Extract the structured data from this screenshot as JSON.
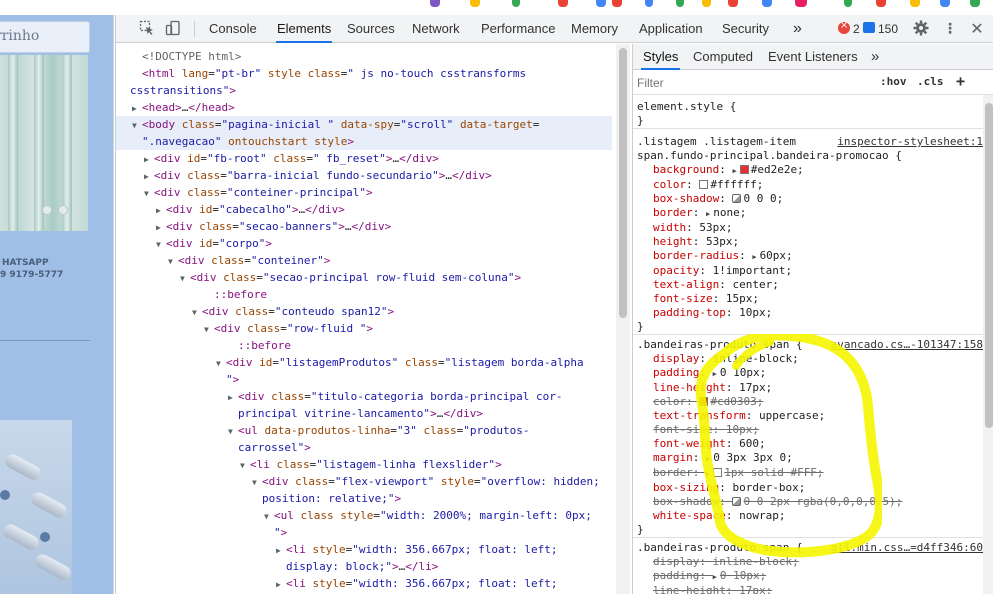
{
  "page_preview": {
    "search_text": "rrinho",
    "whatsapp_label": "HATSAPP",
    "phone": "9 9179-5777"
  },
  "toolbar": {
    "tabs": [
      "Console",
      "Elements",
      "Sources",
      "Network",
      "Performance",
      "Memory",
      "Application",
      "Security"
    ],
    "active_tab": "Elements",
    "more_tabs": "»",
    "error_count": "2",
    "message_count": "150"
  },
  "elements_tree": [
    {
      "indent": 12,
      "tri": "",
      "html": "<!DOCTYPE html>",
      "kind": "comment"
    },
    {
      "indent": 12,
      "tri": "",
      "parts": [
        [
          "t",
          "<html "
        ],
        [
          "a",
          "lang"
        ],
        [
          "p",
          "="
        ],
        [
          "v",
          "\"pt-br\""
        ],
        [
          "p",
          " "
        ],
        [
          "a",
          "style"
        ],
        [
          "p",
          " "
        ],
        [
          "a",
          "class"
        ],
        [
          "p",
          "="
        ],
        [
          "v",
          "\" js no-touch csstransforms"
        ]
      ]
    },
    {
      "indent": 0,
      "tri": "",
      "parts": [
        [
          "v",
          "csstransitions\""
        ],
        [
          "t",
          ">"
        ]
      ]
    },
    {
      "indent": 12,
      "tri": "▶",
      "parts": [
        [
          "t",
          "<head>"
        ],
        [
          "p",
          "…"
        ],
        [
          "t",
          "</head>"
        ]
      ]
    },
    {
      "indent": 12,
      "tri": "▼",
      "sel": true,
      "parts": [
        [
          "t",
          "<body "
        ],
        [
          "a",
          "class"
        ],
        [
          "p",
          "="
        ],
        [
          "v",
          "\"pagina-inicial   \""
        ],
        [
          "p",
          " "
        ],
        [
          "a",
          "data-spy"
        ],
        [
          "p",
          "="
        ],
        [
          "v",
          "\"scroll\""
        ],
        [
          "p",
          " "
        ],
        [
          "a",
          "data-target"
        ],
        [
          "p",
          "="
        ]
      ]
    },
    {
      "indent": 12,
      "tri": "",
      "sel": true,
      "parts": [
        [
          "v",
          "\".navegacao\""
        ],
        [
          "p",
          " "
        ],
        [
          "a",
          "ontouchstart"
        ],
        [
          "p",
          " "
        ],
        [
          "a",
          "style"
        ],
        [
          "t",
          ">"
        ]
      ]
    },
    {
      "indent": 24,
      "tri": "▶",
      "parts": [
        [
          "t",
          "<div "
        ],
        [
          "a",
          "id"
        ],
        [
          "p",
          "="
        ],
        [
          "v",
          "\"fb-root\""
        ],
        [
          "p",
          " "
        ],
        [
          "a",
          "class"
        ],
        [
          "p",
          "="
        ],
        [
          "v",
          "\" fb_reset\""
        ],
        [
          "t",
          ">"
        ],
        [
          "p",
          "…"
        ],
        [
          "t",
          "</div>"
        ]
      ]
    },
    {
      "indent": 24,
      "tri": "▶",
      "parts": [
        [
          "t",
          "<div "
        ],
        [
          "a",
          "class"
        ],
        [
          "p",
          "="
        ],
        [
          "v",
          "\"barra-inicial fundo-secundario\""
        ],
        [
          "t",
          ">"
        ],
        [
          "p",
          "…"
        ],
        [
          "t",
          "</div>"
        ]
      ]
    },
    {
      "indent": 24,
      "tri": "▼",
      "parts": [
        [
          "t",
          "<div "
        ],
        [
          "a",
          "class"
        ],
        [
          "p",
          "="
        ],
        [
          "v",
          "\"conteiner-principal\""
        ],
        [
          "t",
          ">"
        ]
      ]
    },
    {
      "indent": 36,
      "tri": "▶",
      "parts": [
        [
          "t",
          "<div "
        ],
        [
          "a",
          "id"
        ],
        [
          "p",
          "="
        ],
        [
          "v",
          "\"cabecalho\""
        ],
        [
          "t",
          ">"
        ],
        [
          "p",
          "…"
        ],
        [
          "t",
          "</div>"
        ]
      ]
    },
    {
      "indent": 36,
      "tri": "▶",
      "parts": [
        [
          "t",
          "<div "
        ],
        [
          "a",
          "class"
        ],
        [
          "p",
          "="
        ],
        [
          "v",
          "\"secao-banners\""
        ],
        [
          "t",
          ">"
        ],
        [
          "p",
          "…"
        ],
        [
          "t",
          "</div>"
        ]
      ]
    },
    {
      "indent": 36,
      "tri": "▼",
      "parts": [
        [
          "t",
          "<div "
        ],
        [
          "a",
          "id"
        ],
        [
          "p",
          "="
        ],
        [
          "v",
          "\"corpo\""
        ],
        [
          "t",
          ">"
        ]
      ]
    },
    {
      "indent": 48,
      "tri": "▼",
      "parts": [
        [
          "t",
          "<div "
        ],
        [
          "a",
          "class"
        ],
        [
          "p",
          "="
        ],
        [
          "v",
          "\"conteiner\""
        ],
        [
          "t",
          ">"
        ]
      ]
    },
    {
      "indent": 60,
      "tri": "▼",
      "parts": [
        [
          "t",
          "<div "
        ],
        [
          "a",
          "class"
        ],
        [
          "p",
          "="
        ],
        [
          "v",
          "\"secao-principal row-fluid sem-coluna\""
        ],
        [
          "t",
          ">"
        ]
      ]
    },
    {
      "indent": 84,
      "tri": "",
      "parts": [
        [
          "s",
          "::before"
        ]
      ]
    },
    {
      "indent": 72,
      "tri": "▼",
      "parts": [
        [
          "t",
          "<div "
        ],
        [
          "a",
          "class"
        ],
        [
          "p",
          "="
        ],
        [
          "v",
          "\"conteudo span12\""
        ],
        [
          "t",
          ">"
        ]
      ]
    },
    {
      "indent": 84,
      "tri": "▼",
      "parts": [
        [
          "t",
          "<div "
        ],
        [
          "a",
          "class"
        ],
        [
          "p",
          "="
        ],
        [
          "v",
          "\"row-fluid \""
        ],
        [
          "t",
          ">"
        ]
      ]
    },
    {
      "indent": 108,
      "tri": "",
      "parts": [
        [
          "s",
          "::before"
        ]
      ]
    },
    {
      "indent": 96,
      "tri": "▼",
      "parts": [
        [
          "t",
          "<div "
        ],
        [
          "a",
          "id"
        ],
        [
          "p",
          "="
        ],
        [
          "v",
          "\"listagemProdutos\""
        ],
        [
          "p",
          " "
        ],
        [
          "a",
          "class"
        ],
        [
          "p",
          "="
        ],
        [
          "v",
          "\"listagem borda-alpha"
        ]
      ]
    },
    {
      "indent": 96,
      "tri": "",
      "parts": [
        [
          "v",
          "\""
        ],
        [
          "t",
          ">"
        ]
      ]
    },
    {
      "indent": 108,
      "tri": "▶",
      "parts": [
        [
          "t",
          "<div "
        ],
        [
          "a",
          "class"
        ],
        [
          "p",
          "="
        ],
        [
          "v",
          "\"titulo-categoria borda-principal cor-"
        ]
      ]
    },
    {
      "indent": 108,
      "tri": "",
      "parts": [
        [
          "v",
          "principal vitrine-lancamento\""
        ],
        [
          "t",
          ">"
        ],
        [
          "p",
          "…"
        ],
        [
          "t",
          "</div>"
        ]
      ]
    },
    {
      "indent": 108,
      "tri": "▼",
      "parts": [
        [
          "t",
          "<ul "
        ],
        [
          "a",
          "data-produtos-linha"
        ],
        [
          "p",
          "="
        ],
        [
          "v",
          "\"3\""
        ],
        [
          "p",
          " "
        ],
        [
          "a",
          "class"
        ],
        [
          "p",
          "="
        ],
        [
          "v",
          "\"produtos-"
        ]
      ]
    },
    {
      "indent": 108,
      "tri": "",
      "parts": [
        [
          "v",
          "carrossel\""
        ],
        [
          "t",
          ">"
        ]
      ]
    },
    {
      "indent": 120,
      "tri": "▼",
      "parts": [
        [
          "t",
          "<li "
        ],
        [
          "a",
          "class"
        ],
        [
          "p",
          "="
        ],
        [
          "v",
          "\"listagem-linha flexslider\""
        ],
        [
          "t",
          ">"
        ]
      ]
    },
    {
      "indent": 132,
      "tri": "▼",
      "parts": [
        [
          "t",
          "<div "
        ],
        [
          "a",
          "class"
        ],
        [
          "p",
          "="
        ],
        [
          "v",
          "\"flex-viewport\""
        ],
        [
          "p",
          " "
        ],
        [
          "a",
          "style"
        ],
        [
          "p",
          "="
        ],
        [
          "v",
          "\"overflow: hidden;"
        ]
      ]
    },
    {
      "indent": 132,
      "tri": "",
      "parts": [
        [
          "v",
          "position: relative;\""
        ],
        [
          "t",
          ">"
        ]
      ]
    },
    {
      "indent": 144,
      "tri": "▼",
      "parts": [
        [
          "t",
          "<ul "
        ],
        [
          "a",
          "class"
        ],
        [
          "p",
          " "
        ],
        [
          "a",
          "style"
        ],
        [
          "p",
          "="
        ],
        [
          "v",
          "\"width: 2000%; margin-left: 0px;"
        ]
      ]
    },
    {
      "indent": 144,
      "tri": "",
      "parts": [
        [
          "v",
          "\""
        ],
        [
          "t",
          ">"
        ]
      ]
    },
    {
      "indent": 156,
      "tri": "▶",
      "parts": [
        [
          "t",
          "<li "
        ],
        [
          "a",
          "style"
        ],
        [
          "p",
          "="
        ],
        [
          "v",
          "\"width: 356.667px; float: left;"
        ]
      ]
    },
    {
      "indent": 156,
      "tri": "",
      "parts": [
        [
          "v",
          "display: block;\""
        ],
        [
          "t",
          ">"
        ],
        [
          "p",
          "…"
        ],
        [
          "t",
          "</li>"
        ]
      ]
    },
    {
      "indent": 156,
      "tri": "▶",
      "parts": [
        [
          "t",
          "<li "
        ],
        [
          "a",
          "style"
        ],
        [
          "p",
          "="
        ],
        [
          "v",
          "\"width: 356.667px; float: left;"
        ]
      ]
    },
    {
      "indent": 156,
      "tri": "",
      "parts": [
        [
          "v",
          "display: block;\""
        ],
        [
          "t",
          ">"
        ],
        [
          "p",
          "…"
        ],
        [
          "t",
          "</li>"
        ]
      ]
    }
  ],
  "styles": {
    "tabs": [
      "Styles",
      "Computed",
      "Event Listeners"
    ],
    "active_tab": "Styles",
    "more": "»",
    "filter_placeholder": "Filter",
    "hov": ":hov",
    "cls": ".cls",
    "plus": "+",
    "rules": [
      {
        "selector": [
          "element.style {"
        ],
        "source": "",
        "decls": [],
        "close": "}"
      },
      {
        "selector": [
          ".listagem .listagem-item",
          "span.fundo-principal.bandeira-promocao {"
        ],
        "source": "inspector-stylesheet:1",
        "decls": [
          {
            "n": "background",
            "v": "#ed2e2e;",
            "arrow": true,
            "swatch": "#ed2e2e"
          },
          {
            "n": "color",
            "v": "#ffffff;",
            "swatch": "#ffffff"
          },
          {
            "n": "box-shadow",
            "v": "0 0 0;",
            "shadow": true
          },
          {
            "n": "border",
            "v": "none;",
            "arrow": true
          },
          {
            "n": "width",
            "v": "53px;"
          },
          {
            "n": "height",
            "v": "53px;"
          },
          {
            "n": "border-radius",
            "v": "60px;",
            "arrow": true
          },
          {
            "n": "opacity",
            "v": "1!important;"
          },
          {
            "n": "text-align",
            "v": "center;"
          },
          {
            "n": "font-size",
            "v": "15px;"
          },
          {
            "n": "padding-top",
            "v": "10px;"
          }
        ],
        "close": "}"
      },
      {
        "selector": [
          ".bandeiras-produto span {"
        ],
        "source": "avancado.cs…-101347:158",
        "decls": [
          {
            "n": "display",
            "v": "inline-block;"
          },
          {
            "n": "padding",
            "v": "0 10px;",
            "arrow": true
          },
          {
            "n": "line-height",
            "v": "17px;"
          },
          {
            "n": "color",
            "v": "#cd0303;",
            "swatch": "#cd0303",
            "strike": true
          },
          {
            "n": "text-transform",
            "v": "uppercase;"
          },
          {
            "n": "font-size",
            "v": "10px;",
            "strike": true
          },
          {
            "n": "font-weight",
            "v": "600;"
          },
          {
            "n": "margin",
            "v": "0 3px 3px 0;",
            "arrow": true
          },
          {
            "n": "border",
            "v": "1px solid #FFF;",
            "arrow": true,
            "swatch": "#ffffff",
            "strike": true
          },
          {
            "n": "box-sizing",
            "v": "border-box;"
          },
          {
            "n": "box-shadow",
            "v": "0 0 2px rgba(0,0,0,0.5);",
            "shadow": true,
            "swatch2": "#777777",
            "strike": true
          },
          {
            "n": "white-space",
            "v": "nowrap;"
          }
        ],
        "close": "}"
      },
      {
        "selector": [
          ".bandeiras-produto span {"
        ],
        "source": "all.min.css…=d4ff346:60",
        "decls": [
          {
            "n": "display",
            "v": "inline-block;",
            "strike": true
          },
          {
            "n": "padding",
            "v": "0 10px;",
            "arrow": true,
            "strike": true
          },
          {
            "n": "line-height",
            "v": "17px;",
            "strike": true
          }
        ],
        "close": ""
      }
    ]
  }
}
